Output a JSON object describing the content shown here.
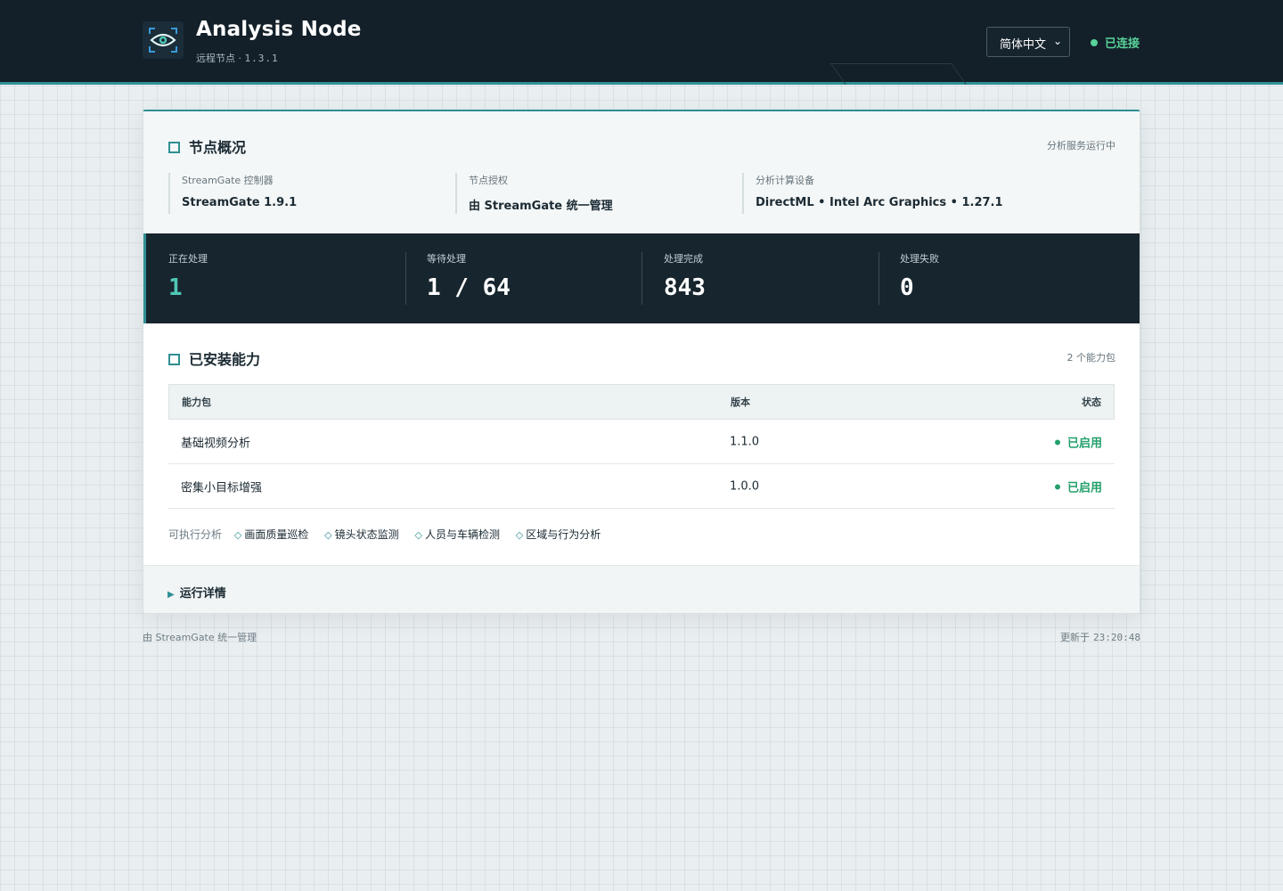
{
  "header": {
    "title": "Analysis Node",
    "subtitle": "远程节点",
    "separator": "·",
    "version": "1.3.1",
    "language": "简体中文",
    "connection_status": "已连接",
    "logo_icon": "eye-scan-icon"
  },
  "overview": {
    "title": "节点概况",
    "service_status": "分析服务运行中",
    "items": [
      {
        "label": "StreamGate 控制器",
        "value": "StreamGate 1.9.1"
      },
      {
        "label": "节点授权",
        "value": "由 StreamGate 统一管理"
      },
      {
        "label": "分析计算设备",
        "value": "DirectML • Intel Arc Graphics • 1.27.1"
      }
    ]
  },
  "stats": [
    {
      "label": "正在处理",
      "value": "1"
    },
    {
      "label": "等待处理",
      "value": "1 / 64"
    },
    {
      "label": "处理完成",
      "value": "843"
    },
    {
      "label": "处理失败",
      "value": "0"
    }
  ],
  "capabilities": {
    "title": "已安装能力",
    "count_label": "2 个能力包",
    "columns": {
      "name": "能力包",
      "version": "版本",
      "status": "状态"
    },
    "rows": [
      {
        "name": "基础视频分析",
        "version": "1.1.0",
        "status": "已启用"
      },
      {
        "name": "密集小目标增强",
        "version": "1.0.0",
        "status": "已启用"
      }
    ],
    "analyses_label": "可执行分析",
    "analyses": [
      "画面质量巡检",
      "镜头状态监测",
      "人员与车辆检测",
      "区域与行为分析"
    ]
  },
  "details": {
    "label": "运行详情"
  },
  "footer": {
    "managed_by": "由 StreamGate 统一管理",
    "updated_label": "更新于",
    "updated_time": "23:20:48"
  },
  "colors": {
    "header_bg": "#132029",
    "accent": "#2f8f93",
    "status_green": "#23a06b",
    "connected_green": "#58d39a",
    "processing_teal": "#4fc7b6"
  }
}
